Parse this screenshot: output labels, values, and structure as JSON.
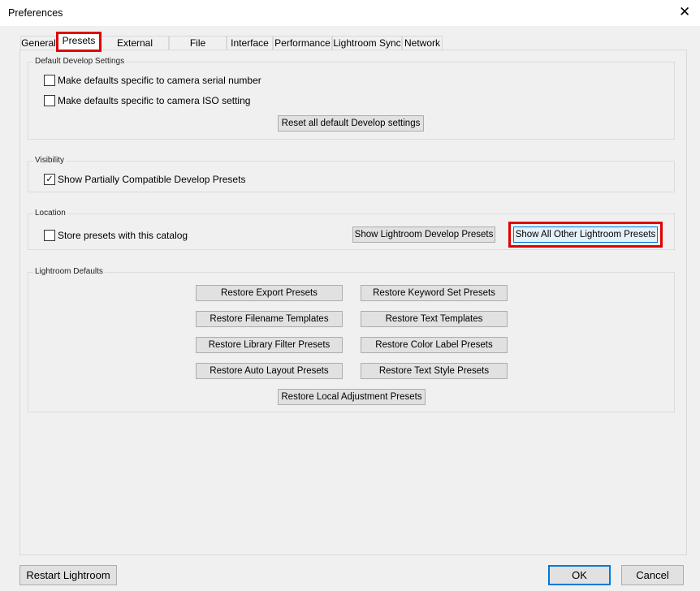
{
  "window": {
    "title": "Preferences",
    "close": "✕"
  },
  "tabs": [
    "General",
    "Presets",
    "External Editing",
    "File Handling",
    "Interface",
    "Performance",
    "Lightroom Sync",
    "Network"
  ],
  "default_develop": {
    "label": "Default Develop Settings",
    "serial": "Make defaults specific to camera serial number",
    "iso": "Make defaults specific to camera ISO setting",
    "reset": "Reset all default Develop settings"
  },
  "visibility": {
    "label": "Visibility",
    "partial": "Show Partially Compatible Develop Presets",
    "check": "✓"
  },
  "location": {
    "label": "Location",
    "store": "Store presets with this catalog",
    "show_develop": "Show Lightroom Develop Presets",
    "show_other": "Show All Other Lightroom Presets"
  },
  "defaults": {
    "label": "Lightroom Defaults",
    "buttons": [
      "Restore Export Presets",
      "Restore Keyword Set Presets",
      "Restore Filename Templates",
      "Restore Text Templates",
      "Restore Library Filter Presets",
      "Restore Color Label Presets",
      "Restore Auto Layout Presets",
      "Restore Text Style Presets",
      "Restore Local Adjustment Presets"
    ]
  },
  "footer": {
    "restart": "Restart Lightroom",
    "ok": "OK",
    "cancel": "Cancel"
  }
}
